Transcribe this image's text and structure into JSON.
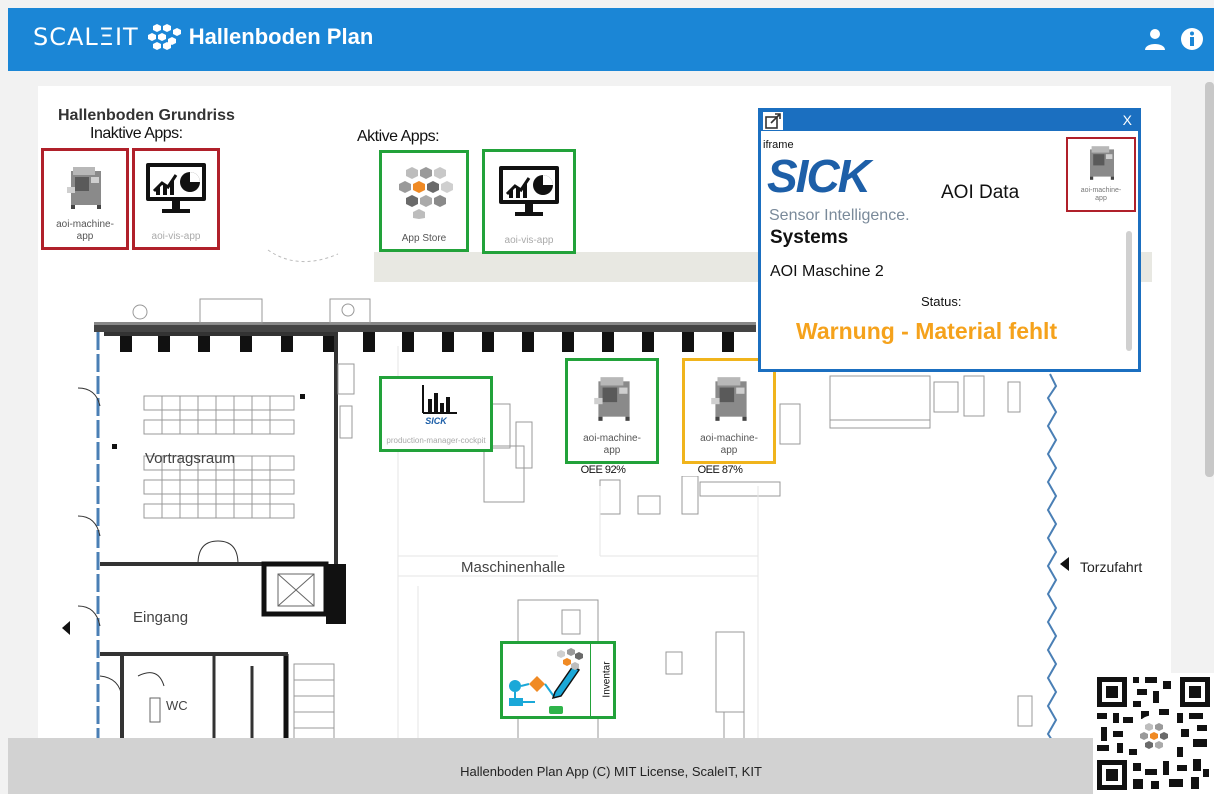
{
  "header": {
    "brand": "SCALΞIT",
    "title": "Hallenboden Plan",
    "user_icon": "user-icon",
    "info_icon": "info-icon",
    "color": "#1b86d6"
  },
  "plan": {
    "heading": "Hallenboden Grundriss",
    "inactive_label": "Inaktive Apps:",
    "active_label": "Aktive Apps:",
    "inactive_apps": [
      {
        "caption": "aoi-machine-\napp",
        "icon": "machine-icon"
      },
      {
        "caption": "aoi-vis-app",
        "icon": "monitor-chart-icon"
      }
    ],
    "active_apps": [
      {
        "caption": "App Store",
        "icon": "hexagon-cluster-icon"
      },
      {
        "caption": "aoi-vis-app",
        "icon": "monitor-chart-icon"
      }
    ],
    "floor_apps": {
      "cockpit": {
        "brand": "SICK",
        "caption": "production-manager-cockpit"
      },
      "machine1": {
        "caption": "aoi-machine-\napp",
        "oee": "OEE 92%",
        "status_color": "#22a23a"
      },
      "machine2": {
        "caption": "aoi-machine-\napp",
        "oee": "OEE 87%",
        "status_color": "#f0b41c"
      },
      "inventar": {
        "caption": "Inventar"
      }
    },
    "rooms": {
      "vortrag": "Vortragsraum",
      "halle": "Maschinenhalle",
      "eingang": "Eingang",
      "wc": "WC",
      "torzufahrt": "Torzufahrt"
    }
  },
  "popup": {
    "close": "X",
    "iframe_label": "iframe",
    "logo": "SICK",
    "tagline": "Sensor Intelligence.",
    "aoi_data": "AOI Data",
    "systems": "Systems",
    "machine": "AOI Maschine 2",
    "status_label": "Status:",
    "status_value": "Warnung - Material fehlt",
    "tile_caption": "aoi-machine-\napp",
    "border_color": "#1b6fc0",
    "status_color": "#f5a21c"
  },
  "footer": {
    "text": "Hallenboden Plan App (C) MIT License, ScaleIT, KIT"
  }
}
